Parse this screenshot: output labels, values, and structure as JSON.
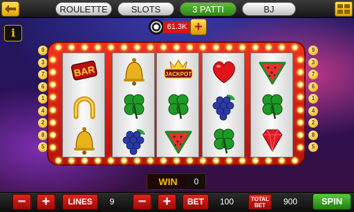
{
  "tabs": [
    {
      "label": "ROULETTE",
      "active": false
    },
    {
      "label": "SLOTS",
      "active": false
    },
    {
      "label": "3 PATTI",
      "active": true
    },
    {
      "label": "BJ",
      "active": false
    }
  ],
  "info_label": "i",
  "balance": {
    "value": "61.3K",
    "add_label": "+"
  },
  "line_numbers_left": [
    "9",
    "3",
    "7",
    "6",
    "1",
    "4",
    "2",
    "8",
    "5"
  ],
  "line_numbers_right": [
    "9",
    "3",
    "7",
    "6",
    "1",
    "4",
    "2",
    "8",
    "5"
  ],
  "reels": [
    [
      "bar",
      "horseshoe",
      "bell"
    ],
    [
      "bell",
      "clover",
      "grapes"
    ],
    [
      "jackpot",
      "clover",
      "watermelon"
    ],
    [
      "heart",
      "grapes",
      "clover"
    ],
    [
      "watermelon",
      "clover",
      "diamond"
    ]
  ],
  "symbol_text": {
    "bar": "BAR",
    "jackpot": "JACKPOT"
  },
  "win": {
    "label": "WIN",
    "value": "0"
  },
  "controls": {
    "minus_label": "−",
    "plus_label": "+",
    "lines_label": "LINES",
    "lines_value": "9",
    "bet_label": "BET",
    "bet_value": "100",
    "total_bet_label_1": "TOTAL",
    "total_bet_label_2": "BET",
    "total_bet_value": "900",
    "spin_label": "SPIN"
  },
  "colors": {
    "frame": "#e0261a",
    "active_tab": "#3a9a1f",
    "balance_bg": "#d4171b",
    "gold": "#f6c000"
  }
}
